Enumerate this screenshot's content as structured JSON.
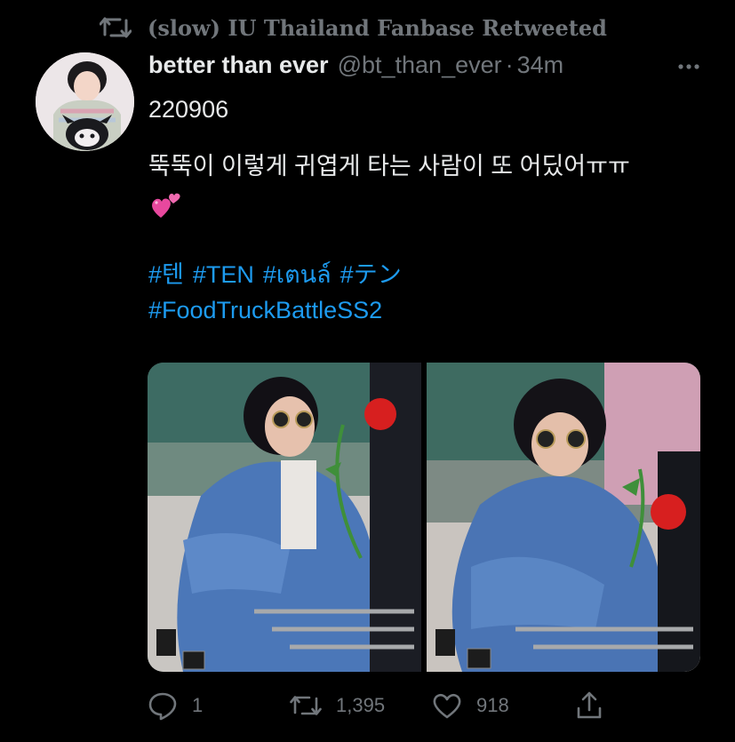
{
  "social_context": {
    "text": "(slow) IU Thailand Fanbase Retweeted",
    "icon": "retweet-icon"
  },
  "author": {
    "display_name": "better than ever",
    "handle": "@bt_than_ever",
    "separator": "·",
    "time": "34m",
    "avatar_icon": "avatar"
  },
  "tweet": {
    "line1": "220906",
    "line2": "뚝뚝이 이렇게 귀엽게 타는 사람이 또 어딨어ㅠㅠ",
    "emoji": "two-hearts-emoji",
    "hashtags_row1": [
      "#텐",
      "#TEN",
      "#เตนล์",
      "#テン"
    ],
    "hashtags_row2": [
      "#FoodTruckBattleSS2"
    ]
  },
  "media": {
    "photos": [
      {
        "name": "photo-1"
      },
      {
        "name": "photo-2"
      }
    ]
  },
  "actions": {
    "reply_count": "1",
    "retweet_count": "1,395",
    "like_count": "918"
  },
  "colors": {
    "background": "#000000",
    "text": "#e7e9ea",
    "muted": "#71767b",
    "link": "#1d9bf0"
  }
}
